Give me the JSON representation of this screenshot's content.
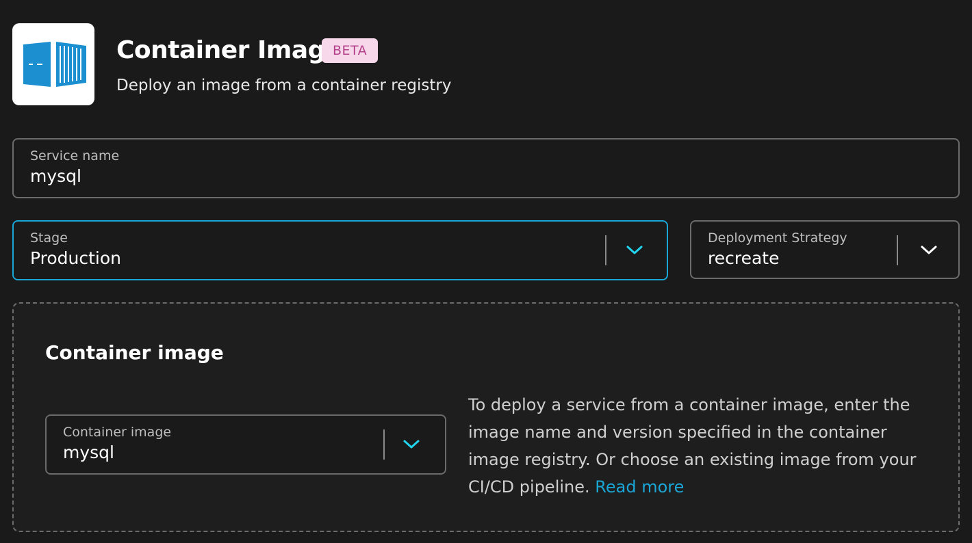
{
  "header": {
    "title": "Container Image",
    "badge": "BETA",
    "subtitle": "Deploy an image from a container registry",
    "logo_icon": "shipping-container-icon"
  },
  "form": {
    "service_name": {
      "label": "Service name",
      "value": "mysql"
    },
    "stage": {
      "label": "Stage",
      "value": "Production"
    },
    "deployment_strategy": {
      "label": "Deployment Strategy",
      "value": "recreate"
    }
  },
  "container_panel": {
    "title": "Container image",
    "image_field": {
      "label": "Container image",
      "value": "mysql"
    },
    "help_text": "To deploy a service from a container image, enter the image name and version specified in the container image registry. Or choose an existing image from your CI/CD pipeline.",
    "read_more": "Read more"
  },
  "colors": {
    "background": "#1a1a1a",
    "accent": "#1aa6d6",
    "chevron_accent": "#22d3ee",
    "badge_bg": "#f6d8ea",
    "badge_text": "#b5408a",
    "logo_blue": "#1b8fcf"
  }
}
